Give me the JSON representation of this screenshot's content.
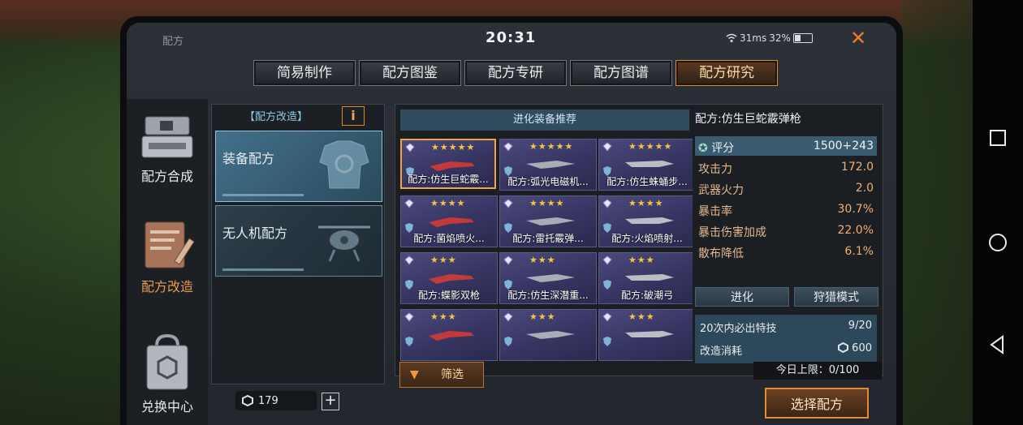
{
  "header": {
    "title": "配方",
    "clock": "20:31",
    "network": "31ms",
    "battery": "32%"
  },
  "tabs": [
    {
      "label": "简易制作"
    },
    {
      "label": "配方图鉴"
    },
    {
      "label": "配方专研"
    },
    {
      "label": "配方图谱"
    },
    {
      "label": "配方研究",
      "active": true
    }
  ],
  "sidebar": {
    "items": [
      {
        "label": "配方合成",
        "icon": "craft-machine-icon"
      },
      {
        "label": "配方改造",
        "icon": "blueprint-edit-icon",
        "active": true
      },
      {
        "label": "兑换中心",
        "icon": "exchange-bag-icon"
      }
    ]
  },
  "mid": {
    "header": "【配方改造】",
    "info_label": "i",
    "cards": [
      {
        "label": "装备配方",
        "active": true
      },
      {
        "label": "无人机配方"
      }
    ],
    "currency_value": "179"
  },
  "list": {
    "recommend_label": "进化装备推荐",
    "items": [
      {
        "name": "配方:仿生巨蛇霰...",
        "stars": "★★★★★",
        "selected": true
      },
      {
        "name": "配方:弧光电磁机...",
        "stars": "★★★★★"
      },
      {
        "name": "配方:仿生蛛蛹步...",
        "stars": "★★★★★"
      },
      {
        "name": "配方:菌焰喷火...",
        "stars": "★★★★"
      },
      {
        "name": "配方:雷托霰弹...",
        "stars": "★★★★"
      },
      {
        "name": "配方:火焰喷射...",
        "stars": "★★★★"
      },
      {
        "name": "配方:蝶影双枪",
        "stars": "★★★"
      },
      {
        "name": "配方:仿生深潜重...",
        "stars": "★★★"
      },
      {
        "name": "配方:破潮弓",
        "stars": "★★★"
      },
      {
        "name": "",
        "stars": "★★★"
      },
      {
        "name": "",
        "stars": "★★★"
      },
      {
        "name": "",
        "stars": "★★★"
      }
    ],
    "filter_label": "筛选"
  },
  "detail": {
    "title": "配方:仿生巨蛇霰弹枪",
    "stats": [
      {
        "k": "评分",
        "v": "1500+243"
      },
      {
        "k": "攻击力",
        "v": "172.0"
      },
      {
        "k": "武器火力",
        "v": "2.0"
      },
      {
        "k": "暴击率",
        "v": "30.7%"
      },
      {
        "k": "暴击伤害加成",
        "v": "22.0%"
      },
      {
        "k": "散布降低",
        "v": "6.1%"
      }
    ],
    "evolve_label": "进化",
    "hunt_label": "狩猎模式",
    "guarantee_label": "20次内必出特技",
    "guarantee_value": "9/20",
    "cost_label": "改造消耗",
    "cost_value": "600",
    "limit_label": "今日上限：",
    "limit_value": "0/100",
    "choose_label": "选择配方"
  },
  "colors": {
    "accent": "#e28a34",
    "selected_tab": "#e08a2e",
    "highlight_blue": "#3a5b70"
  }
}
